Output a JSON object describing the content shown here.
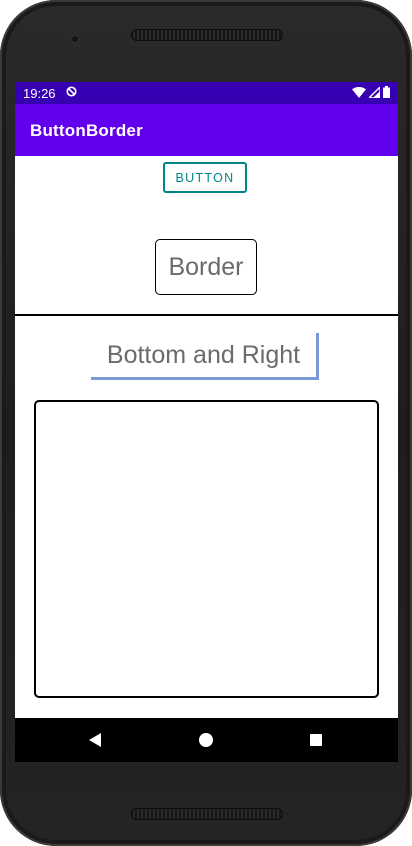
{
  "status_bar": {
    "time": "19:26",
    "icons": [
      "sync-icon",
      "wifi-icon",
      "cellular-signal-icon",
      "battery-icon"
    ],
    "background": "#3700b3"
  },
  "app_bar": {
    "title": "ButtonBorder",
    "background": "#6200ee"
  },
  "main": {
    "outlined_button": {
      "label": "BUTTON",
      "color": "#00858a"
    },
    "border_button": {
      "label": "Border"
    },
    "bottom_right_button": {
      "label": "Bottom and Right",
      "border_color": "#7c9bd4"
    }
  },
  "nav_bar": {
    "buttons": [
      "back-icon",
      "home-icon",
      "recents-icon"
    ]
  }
}
